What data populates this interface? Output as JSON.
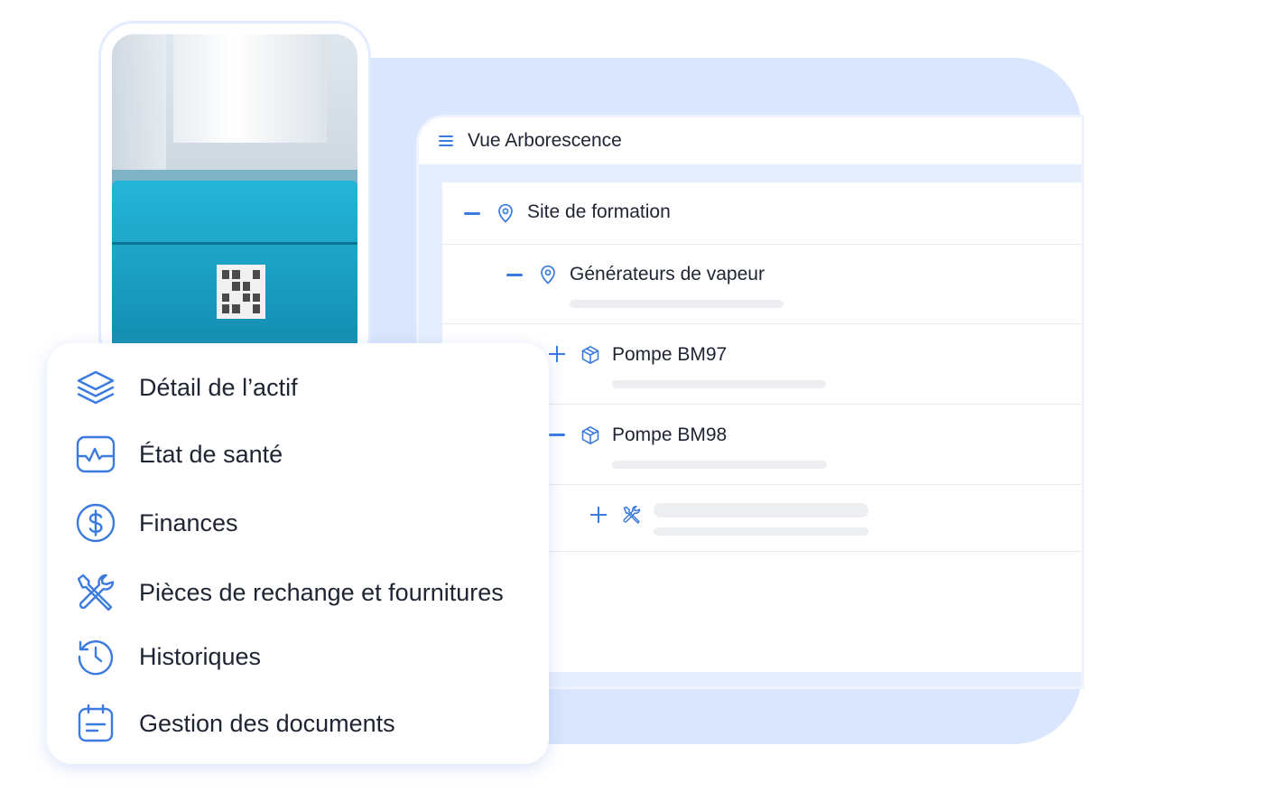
{
  "tree": {
    "title": "Vue Arborescence",
    "nodes": [
      {
        "label": "Site de formation",
        "toggle": "minus",
        "icon": "location-pin-icon"
      },
      {
        "label": "Générateurs de vapeur",
        "toggle": "minus",
        "icon": "location-pin-icon"
      },
      {
        "label": "Pompe BM97",
        "toggle": "plus",
        "icon": "box-icon"
      },
      {
        "label": "Pompe BM98",
        "toggle": "minus",
        "icon": "box-icon"
      },
      {
        "label": "",
        "toggle": "plus",
        "icon": "tools-icon"
      }
    ]
  },
  "menu": {
    "items": [
      {
        "label": "Détail de l’actif",
        "icon": "layers-icon"
      },
      {
        "label": "État de santé",
        "icon": "health-pulse-icon"
      },
      {
        "label": "Finances",
        "icon": "dollar-circle-icon"
      },
      {
        "label": "Pièces de rechange et fournitures",
        "icon": "tools-icon"
      },
      {
        "label": "Historiques",
        "icon": "history-icon"
      },
      {
        "label": "Gestion des documents",
        "icon": "document-calendar-icon"
      }
    ]
  },
  "colors": {
    "accent": "#3b7be0",
    "background_shape": "#d9e6fd",
    "text": "#1e2432"
  }
}
